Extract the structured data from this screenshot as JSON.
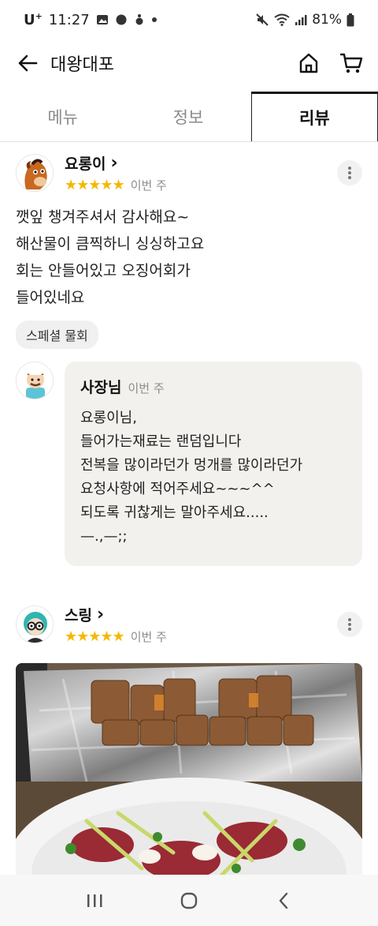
{
  "status_bar": {
    "carrier": "U",
    "carrier_sup": "+",
    "time": "11:27",
    "battery": "81%"
  },
  "header": {
    "title": "대왕대포"
  },
  "tabs": [
    {
      "label": "메뉴",
      "active": false
    },
    {
      "label": "정보",
      "active": false
    },
    {
      "label": "리뷰",
      "active": true
    }
  ],
  "reviews": [
    {
      "nickname": "요롱이",
      "chevron": "›",
      "stars": "★★★★★",
      "rating": 5,
      "date": "이번 주",
      "text": "깻잎 챙겨주셔서  감사해요~\n해산물이 큼찍하니 싱싱하고요\n회는 안들어있고 오징어회가\n들어있네요",
      "menu_chip": "스페셜 물회",
      "reply": {
        "author": "사장님",
        "date": "이번 주",
        "text": "요롱이님,\n들어가는재료는   랜덤입니다\n전복을  많이라던가 멍개를 많이라던가\n요청사항에 적어주세요~~~^^\n되도록 귀찮게는  말아주세요.....\n—.,—;;"
      }
    },
    {
      "nickname": "스링",
      "chevron": "›",
      "stars": "★★★★★",
      "rating": 5,
      "date": "이번 주"
    }
  ],
  "icons": {
    "back": "back-arrow-icon",
    "home": "home-icon",
    "cart": "cart-icon",
    "more": "more-vertical-icon"
  },
  "colors": {
    "star": "#f5b800",
    "reply_bg": "#f3f1ee"
  }
}
